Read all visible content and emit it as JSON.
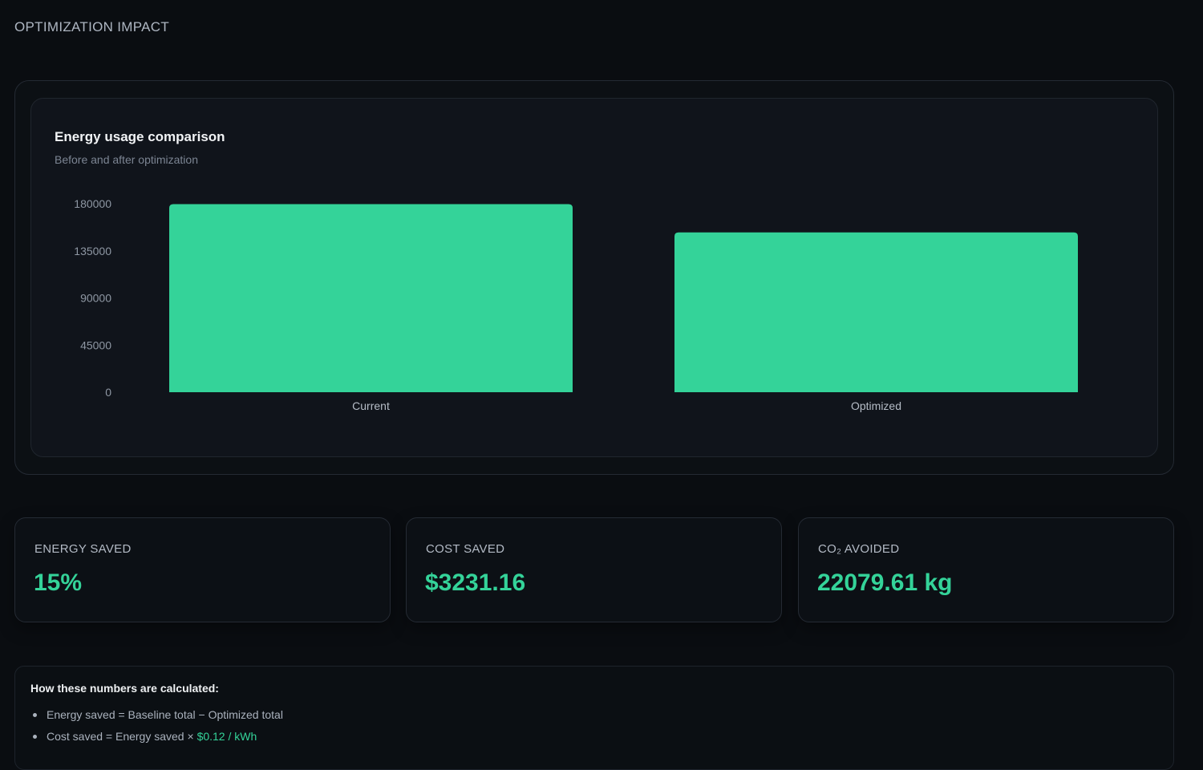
{
  "header": {
    "title": "OPTIMIZATION IMPACT"
  },
  "chart_card": {
    "title": "Energy usage comparison",
    "subtitle": "Before and after optimization"
  },
  "chart_data": {
    "type": "bar",
    "categories": [
      "Current",
      "Optimized"
    ],
    "values": [
      179600,
      152660
    ],
    "yticks": [
      0,
      45000,
      90000,
      135000,
      180000
    ],
    "ylim": [
      0,
      180000
    ],
    "title": "Energy usage comparison",
    "subtitle": "Before and after optimization",
    "xlabel": "",
    "ylabel": "",
    "bar_color": "#34d399",
    "grid": false
  },
  "stats": [
    {
      "label": "ENERGY SAVED",
      "value": "15%"
    },
    {
      "label": "COST SAVED",
      "value": "$3231.16"
    },
    {
      "label": "CO₂ AVOIDED",
      "value": "22079.61 kg"
    }
  ],
  "info": {
    "title": "How these numbers are calculated:",
    "items": [
      {
        "text": "Energy saved = Baseline total − Optimized total",
        "accent": ""
      },
      {
        "text": "Cost saved = Energy saved × ",
        "accent": "$0.12 / kWh"
      }
    ]
  },
  "colors": {
    "background": "#0a0d11",
    "accent": "#34d399",
    "card": "#10141b"
  }
}
